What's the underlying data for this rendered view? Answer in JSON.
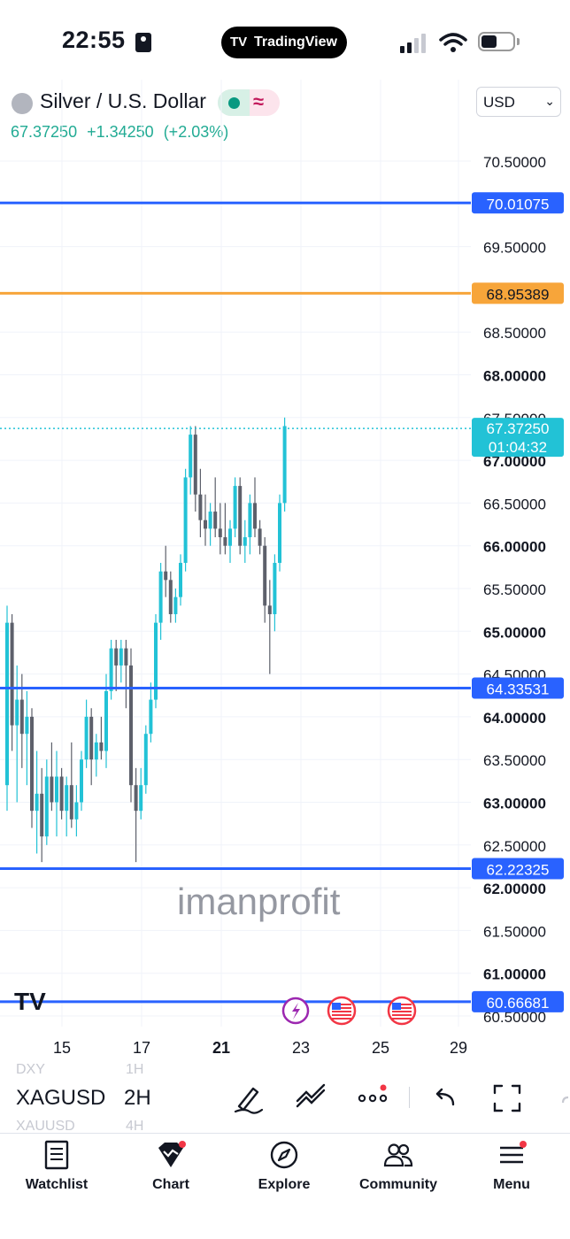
{
  "status_bar": {
    "time": "22:55",
    "app_pill": "TradingView"
  },
  "header": {
    "symbol_title": "Silver / U.S. Dollar",
    "quote": {
      "last": "67.37250",
      "change": "+1.34250",
      "change_pct": "(+2.03%)"
    },
    "currency": "USD"
  },
  "chart": {
    "price_axis_labels": [
      "70.50000",
      "69.50000",
      "68.50000",
      "68.00000",
      "67.50000",
      "67.00000",
      "66.50000",
      "66.00000",
      "65.50000",
      "65.00000",
      "64.50000",
      "64.00000",
      "63.50000",
      "63.00000",
      "62.50000",
      "62.00000",
      "61.50000",
      "61.00000",
      "60.50000"
    ],
    "date_axis_labels": [
      "15",
      "17",
      "21",
      "23",
      "25",
      "29"
    ],
    "horizontal_lines": [
      {
        "value": "70.01075",
        "color": "#2962ff"
      },
      {
        "value": "68.95389",
        "color": "#f7a53a"
      },
      {
        "value": "64.33531",
        "color": "#2962ff"
      },
      {
        "value": "62.22325",
        "color": "#2962ff"
      },
      {
        "value": "60.66681",
        "color": "#2962ff"
      }
    ],
    "last_price_label": {
      "value": "67.37250",
      "countdown": "01:04:32",
      "color": "#22c2d6"
    },
    "watermark": "imanprofit",
    "colors": {
      "up": "#22c2d6",
      "down": "#5d606b",
      "line_blue": "#2962ff",
      "line_orange": "#f7a53a"
    }
  },
  "toolbar": {
    "symbol": "XAGUSD",
    "interval": "2H",
    "ghost_symbols": [
      "DXY",
      "XAUUSD"
    ],
    "ghost_intervals": [
      "1H",
      "4H"
    ]
  },
  "bottom_nav": {
    "items": [
      {
        "label": "Watchlist",
        "icon": "watchlist-icon"
      },
      {
        "label": "Chart",
        "icon": "chart-icon"
      },
      {
        "label": "Explore",
        "icon": "compass-icon"
      },
      {
        "label": "Community",
        "icon": "community-icon"
      },
      {
        "label": "Menu",
        "icon": "menu-icon"
      }
    ]
  }
}
